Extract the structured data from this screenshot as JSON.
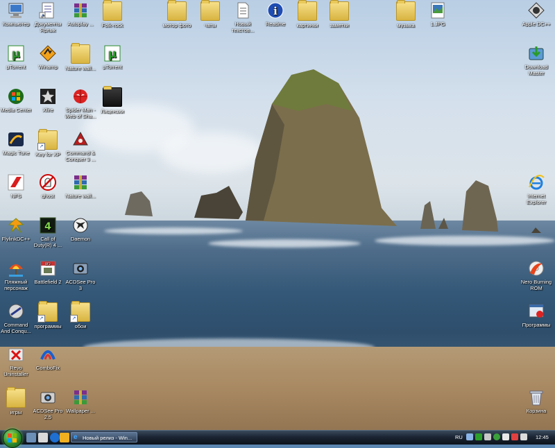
{
  "desktop": {
    "icons": [
      {
        "label": "Компьютер",
        "kind": "computer"
      },
      {
        "label": "Документы\nЯрлык",
        "kind": "docs"
      },
      {
        "label": "Autoplay ...",
        "kind": "rar"
      },
      {
        "label": "Folk-rock",
        "kind": "folder"
      },
      {
        "label": "µTorrent",
        "kind": "utorrent"
      },
      {
        "label": "Winamp",
        "kind": "winamp"
      },
      {
        "label": "Nature wall...",
        "kind": "folder"
      },
      {
        "label": "µTorrent",
        "kind": "utorrent"
      },
      {
        "label": "Media Center",
        "kind": "mediacenter"
      },
      {
        "label": "Xfire",
        "kind": "star"
      },
      {
        "label": "Spider Man - Web of Sha...",
        "kind": "spiderman"
      },
      {
        "label": "Лицензии",
        "kind": "folder"
      },
      {
        "label": "Magic Tune",
        "kind": "magic"
      },
      {
        "label": "Key for XP",
        "kind": "folder"
      },
      {
        "label": "Command & Conquer 3 ...",
        "kind": "cnc"
      },
      {
        "label": "NFS",
        "kind": "nfs"
      },
      {
        "label": "ghost",
        "kind": "ghost"
      },
      {
        "label": "Nature wall...",
        "kind": "rar"
      },
      {
        "label": "FlylinkDC++",
        "kind": "flylink"
      },
      {
        "label": "Call of Duty(R) 4 ...",
        "kind": "cod"
      },
      {
        "label": "Daemon",
        "kind": "daemon"
      },
      {
        "label": "Пляжный персонаж",
        "kind": "beach"
      },
      {
        "label": "Battlefield 2",
        "kind": "bf2"
      },
      {
        "label": "ACDSee Pro 3",
        "kind": "acdsee"
      },
      {
        "label": "Command And Conqu...",
        "kind": "cnc2"
      },
      {
        "label": "программы",
        "kind": "folder"
      },
      {
        "label": "обои",
        "kind": "folder"
      },
      {
        "label": "Revo Uninstaller",
        "kind": "revo"
      },
      {
        "label": "ComboFix",
        "kind": "combofix"
      },
      {
        "label": "игры",
        "kind": "folder"
      },
      {
        "label": "ACDSee Pro 2.5",
        "kind": "acdsee2"
      },
      {
        "label": "Wallpaper ...",
        "kind": "rar"
      },
      {
        "label": "мотор фото",
        "kind": "folder"
      },
      {
        "label": "чаты",
        "kind": "folder"
      },
      {
        "label": "Новый текстов...",
        "kind": "textdoc"
      },
      {
        "label": "Readme",
        "kind": "info"
      },
      {
        "label": "картинки",
        "kind": "folder"
      },
      {
        "label": "заметки",
        "kind": "folder"
      },
      {
        "label": "музыка",
        "kind": "folder"
      },
      {
        "label": "1.JPG",
        "kind": "jpg"
      },
      {
        "label": "Apple DC++",
        "kind": "apple"
      },
      {
        "label": "Download Master",
        "kind": "download"
      },
      {
        "label": "Internet Explorer",
        "kind": "ie"
      },
      {
        "label": "Nero Burning ROM",
        "kind": "nero"
      },
      {
        "label": "Программы",
        "kind": "programs"
      },
      {
        "label": "Корзина",
        "kind": "recycle"
      }
    ]
  },
  "taskbar": {
    "start_label": "Пуск",
    "task_button": "Новый релиз - Win...",
    "language": "RU",
    "clock": "12:45"
  }
}
